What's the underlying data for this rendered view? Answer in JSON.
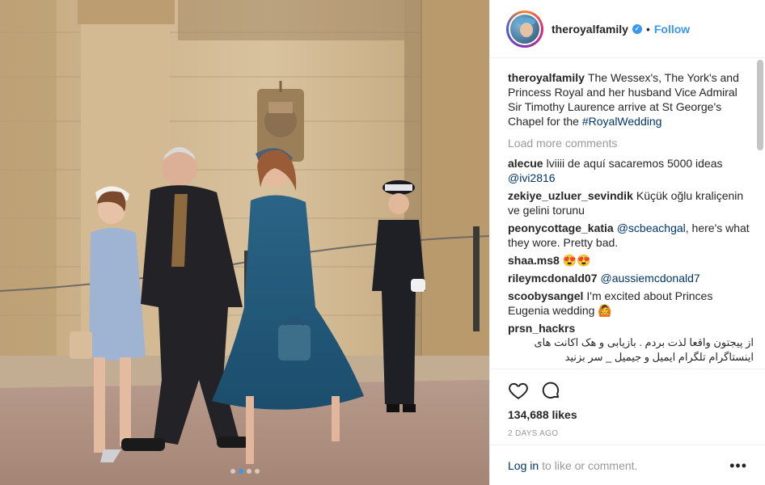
{
  "post": {
    "username": "theroyalfamily",
    "verified_mark": "✓",
    "separator": "•",
    "follow_label": "Follow",
    "caption_user": "theroyalfamily",
    "caption_text": "The Wessex's, The York's and Princess Royal and her husband Vice Admiral Sir Timothy Laurence arrive at St George's Chapel for the",
    "caption_hashtag": "#RoyalWedding",
    "load_more": "Load more comments",
    "likes": "134,688 likes",
    "time": "2 DAYS AGO"
  },
  "comments": [
    {
      "user": "alecue",
      "text": "lviiii de aquí sacaremos 5000 ideas",
      "mention": "@ivi2816"
    },
    {
      "user": "zekiye_uzluer_sevindik",
      "text": "Küçük oğlu kraliçenin ve gelini torunu",
      "mention": ""
    },
    {
      "user": "peonycottage_katia",
      "mention": "@scbeachgal",
      "text": ", here's what they wore. Pretty bad."
    },
    {
      "user": "shaa.ms8",
      "text": "😍😍",
      "mention": ""
    },
    {
      "user": "rileymcdonald07",
      "mention": "@aussiemcdonald7",
      "text": ""
    },
    {
      "user": "scoobysangel",
      "text": "I'm excited about Princes Eugenia wedding 🙆",
      "mention": ""
    },
    {
      "user": "prsn_hackrs",
      "text": "از پیجتون واقعا لذت بردم . بازیابی و هک اکانت های اینستاگرام تلگرام ایمیل و جیمیل _ سر بزنید",
      "mention": ""
    }
  ],
  "footer": {
    "login_link": "Log in",
    "login_rest": "to like or comment.",
    "more": "•••"
  },
  "icons": {
    "like": "heart-icon",
    "comment": "comment-bubble-icon",
    "options": "more-options-icon"
  },
  "colors": {
    "accent": "#3897f0",
    "link": "#003569",
    "muted": "#999999"
  }
}
